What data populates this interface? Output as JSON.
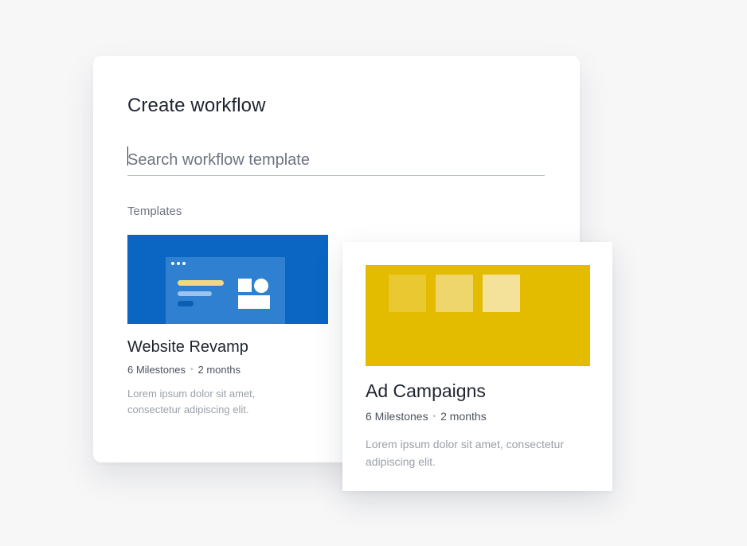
{
  "dialog": {
    "title": "Create workflow",
    "search": {
      "placeholder": "Search workflow template",
      "value": ""
    },
    "section_label": "Templates"
  },
  "templates": [
    {
      "title": "Website Revamp",
      "milestones": "6 Milestones",
      "duration": "2 months",
      "separator": "•",
      "description": "Lorem ipsum dolor sit amet, consectetur adipiscing elit.",
      "thumbnail_color": "#0a66c2"
    },
    {
      "title": "Ad Campaigns",
      "milestones": "6 Milestones",
      "duration": "2 months",
      "separator": "•",
      "description": "Lorem ipsum dolor sit amet, consectetur adipiscing elit.",
      "thumbnail_color": "#e3bc00"
    }
  ],
  "icons": {
    "window_dots": "window-dots-icon",
    "layout_mock": "layout-mock-illustration",
    "tiles": "color-tiles-illustration"
  }
}
